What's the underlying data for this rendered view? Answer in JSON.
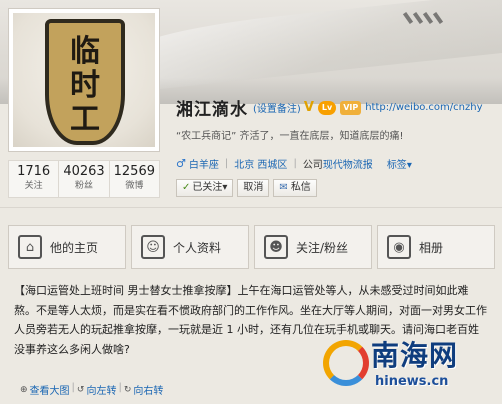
{
  "profile": {
    "nickname": "湘江滴水",
    "set_remark": "(设置备注)",
    "homepage": "http://weibo.com/cnzhy",
    "bio": "“农工兵商记” 齐活了，一直在底层，知道底层的痛!",
    "constellation": "白羊座",
    "location": "北京 西城区",
    "company_prefix": "公司",
    "company": "现代物流报",
    "tag_label": "标签",
    "tag_arrow": "▾",
    "avatar_text": [
      "临",
      "时",
      "工"
    ],
    "badges": {
      "v": "V",
      "level": "Lv",
      "vip": "VIP"
    }
  },
  "stats": [
    {
      "num": "1716",
      "label": "关注"
    },
    {
      "num": "40263",
      "label": "粉丝"
    },
    {
      "num": "12569",
      "label": "微博"
    }
  ],
  "actions": {
    "followed": "已关注",
    "followed_arrow": "▾",
    "cancel": "取消",
    "message": "私信"
  },
  "tabs": [
    {
      "label": "他的主页",
      "icon": "home-icon",
      "glyph": "⌂"
    },
    {
      "label": "个人资料",
      "icon": "person-icon",
      "glyph": "☺"
    },
    {
      "label": "关注/粉丝",
      "icon": "people-icon",
      "glyph": "☻"
    },
    {
      "label": "相册",
      "icon": "camera-icon",
      "glyph": "◉"
    }
  ],
  "post": {
    "title": "【海口运管处上班时间 男士替女士推拿按摩】",
    "body": "上午在海口运管处等人，从未感受过时间如此难熬。不是等人太烦，而是实在看不惯政府部门的工作作风。坐在大厅等人期间，对面一对男女工作人员旁若无人的玩起推拿按摩，一玩就是近 1 小时，还有几位在玩手机或聊天。请问海口老百姓没事养这么多闲人做啥?"
  },
  "post_actions": [
    {
      "label": "查看大图",
      "icon": "zoom-icon",
      "glyph": "⊕"
    },
    {
      "label": "向左转",
      "icon": "rotate-left-icon",
      "glyph": "↺"
    },
    {
      "label": "向右转",
      "icon": "rotate-right-icon",
      "glyph": "↻"
    }
  ],
  "watermark": {
    "cn": "南海网",
    "en": "hinews.cn"
  },
  "colors": {
    "link": "#1a66b3",
    "background": "#ece9e2",
    "badge_orange": "#f8a000"
  }
}
